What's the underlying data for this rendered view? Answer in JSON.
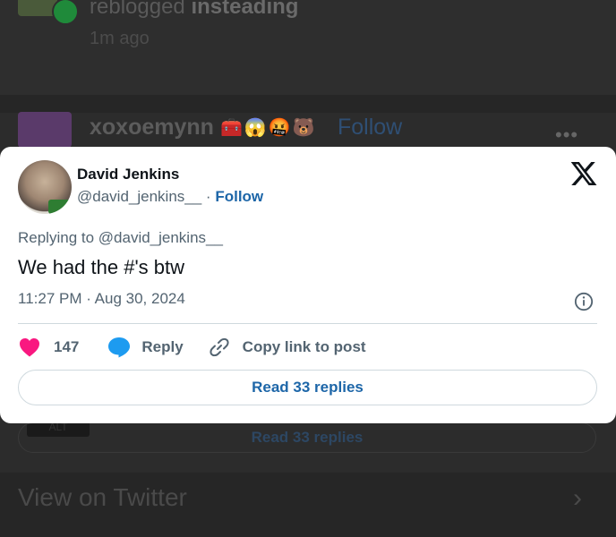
{
  "background": {
    "reblog_text": "reblogged",
    "reblog_user": "insteading",
    "reblog_time": "1m ago",
    "post_user": "xoxoemynn",
    "post_emojis": "🧰😱🤬🐻",
    "post_follow": "Follow",
    "more": "•••",
    "alt_badge": "ALT",
    "read_replies": "Read 33 replies",
    "view_on": "View on Twitter",
    "chevron": "›"
  },
  "tweet": {
    "author_name": "David Jenkins",
    "author_handle": "@david_jenkins__",
    "separator": "·",
    "follow_label": "Follow",
    "replying_to": "Replying to @david_jenkins__",
    "text": "We had the #'s btw",
    "timestamp": "11:27 PM · Aug 30, 2024",
    "like_count": "147",
    "reply_label": "Reply",
    "copy_link_label": "Copy link to post",
    "read_replies_label": "Read 33 replies"
  },
  "colors": {
    "like": "#f91880",
    "reply": "#1d9bf0",
    "link": "#1d66a8"
  },
  "icons": {
    "logo": "x-logo-icon",
    "info": "info-icon",
    "like": "heart-icon",
    "reply": "speech-bubble-icon",
    "copy": "link-icon"
  }
}
